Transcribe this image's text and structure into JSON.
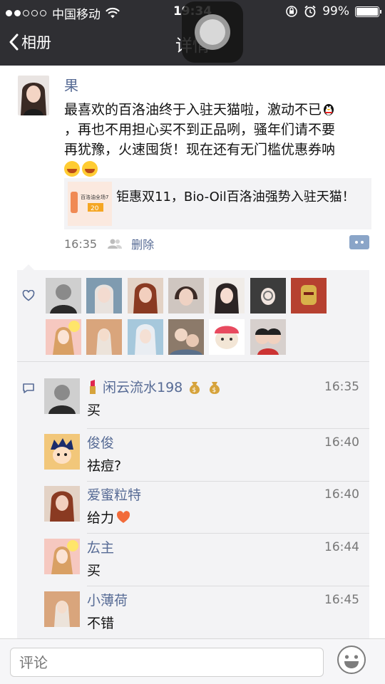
{
  "status_bar": {
    "carrier": "中国移动",
    "time": "19:34",
    "battery": "99%",
    "battery_level": 0.99
  },
  "nav": {
    "back_label": "相册",
    "title": "详情"
  },
  "post": {
    "author": "果",
    "text_lines": [
      "最喜欢的百洛油终于入驻天猫啦，激动不已",
      "，再也不用担心买不到正品咧，骚年们请不要",
      "再犹豫，火速囤货！现在还有无门槛优惠券呐"
    ],
    "link_card": {
      "title": "钜惠双11，Bio-Oil百洛油强势入驻天猫！",
      "thumb_text": "百洛油全场7",
      "thumb_badge": "20"
    },
    "time": "16:35",
    "delete_label": "删除"
  },
  "likes": {
    "icon": "heart-outline-icon",
    "count": 14
  },
  "comments": [
    {
      "name": "闲云流水198",
      "time": "16:35",
      "text": "买",
      "decorations": [
        "lipstick-icon",
        "money-bag-icon",
        "money-bag-icon"
      ]
    },
    {
      "name": "俊俊",
      "time": "16:40",
      "text": "祛痘?"
    },
    {
      "name": "爱蜜粒特",
      "time": "16:40",
      "text": "给力",
      "heart": true
    },
    {
      "name": "厷主",
      "time": "16:44",
      "text": "买"
    },
    {
      "name": "小薄荷",
      "time": "16:45",
      "text": "不错"
    }
  ],
  "input": {
    "placeholder": "评论"
  },
  "colors": {
    "link_blue": "#576b95",
    "nav_bg": "#2f2f33",
    "panel_bg": "#f3f3f5"
  }
}
